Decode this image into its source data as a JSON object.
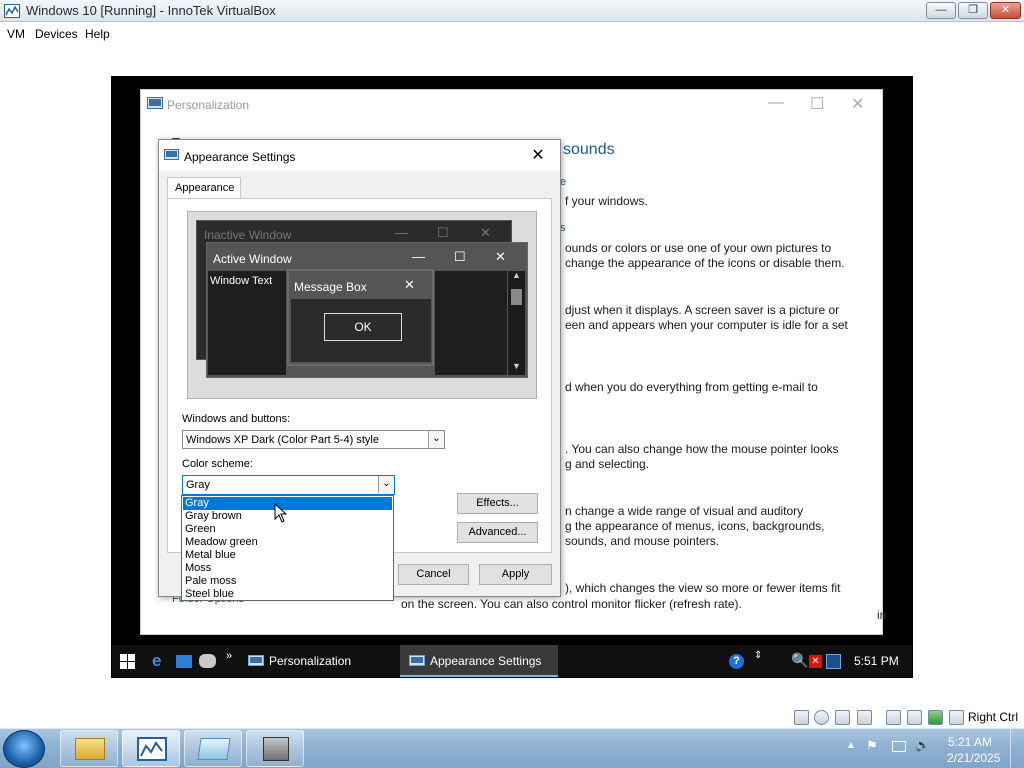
{
  "host_window": {
    "title": "Windows 10 [Running] - InnoTek VirtualBox",
    "menu": [
      "VM",
      "Devices",
      "Help"
    ],
    "host_key_label": "Right Ctrl"
  },
  "personalization": {
    "title": "Personalization",
    "heading_partial": "sounds",
    "left_fragments": [
      "T",
      "Folder Options"
    ],
    "link_fragments": [
      "e",
      "s"
    ],
    "text_lines": [
      "f your windows.",
      "ounds or colors or use one of your own pictures to",
      " change the appearance of the icons or disable them.",
      "djust when it displays. A screen saver is a picture or",
      "een and appears when your computer is idle for a set",
      "d when you do everything from getting e-mail to",
      ". You can also change how the mouse pointer looks",
      "g and selecting.",
      "n change a wide range of visual and auditory",
      "g the appearance of menus, icons, backgrounds,",
      "sounds, and mouse pointers.",
      "), which changes the view so more or fewer items fit",
      "on the screen. You can also control monitor flicker (refresh rate)."
    ],
    "right_edge_fragment": "in"
  },
  "dialog": {
    "title": "Appearance Settings",
    "tab_label": "Appearance",
    "preview": {
      "inactive_title": "Inactive Window",
      "active_title": "Active Window",
      "window_text": "Window Text",
      "msgbox_title": "Message Box",
      "ok_label": "OK"
    },
    "windows_buttons_label": "Windows and buttons:",
    "windows_buttons_value": "Windows XP Dark (Color Part 5-4) style",
    "color_scheme_label": "Color scheme:",
    "color_scheme_value": "Gray",
    "color_scheme_options": [
      "Gray",
      "Gray brown",
      "Green",
      "Meadow green",
      "Metal blue",
      "Moss",
      "Pale moss",
      "Steel blue"
    ],
    "selected_option_index": 0,
    "effects_label": "Effects...",
    "advanced_label": "Advanced...",
    "cancel_label": "Cancel",
    "apply_label": "Apply"
  },
  "guest_taskbar": {
    "items": [
      "Personalization",
      "Appearance Settings"
    ],
    "active_item": "Appearance Settings",
    "clock": "5:51 PM"
  },
  "host_taskbar": {
    "time": "5:21 AM",
    "date": "2/21/2025"
  },
  "colors": {
    "selection": "#0078d7",
    "link": "#1e5a96",
    "taskbar_accent": "#76b9ed"
  }
}
